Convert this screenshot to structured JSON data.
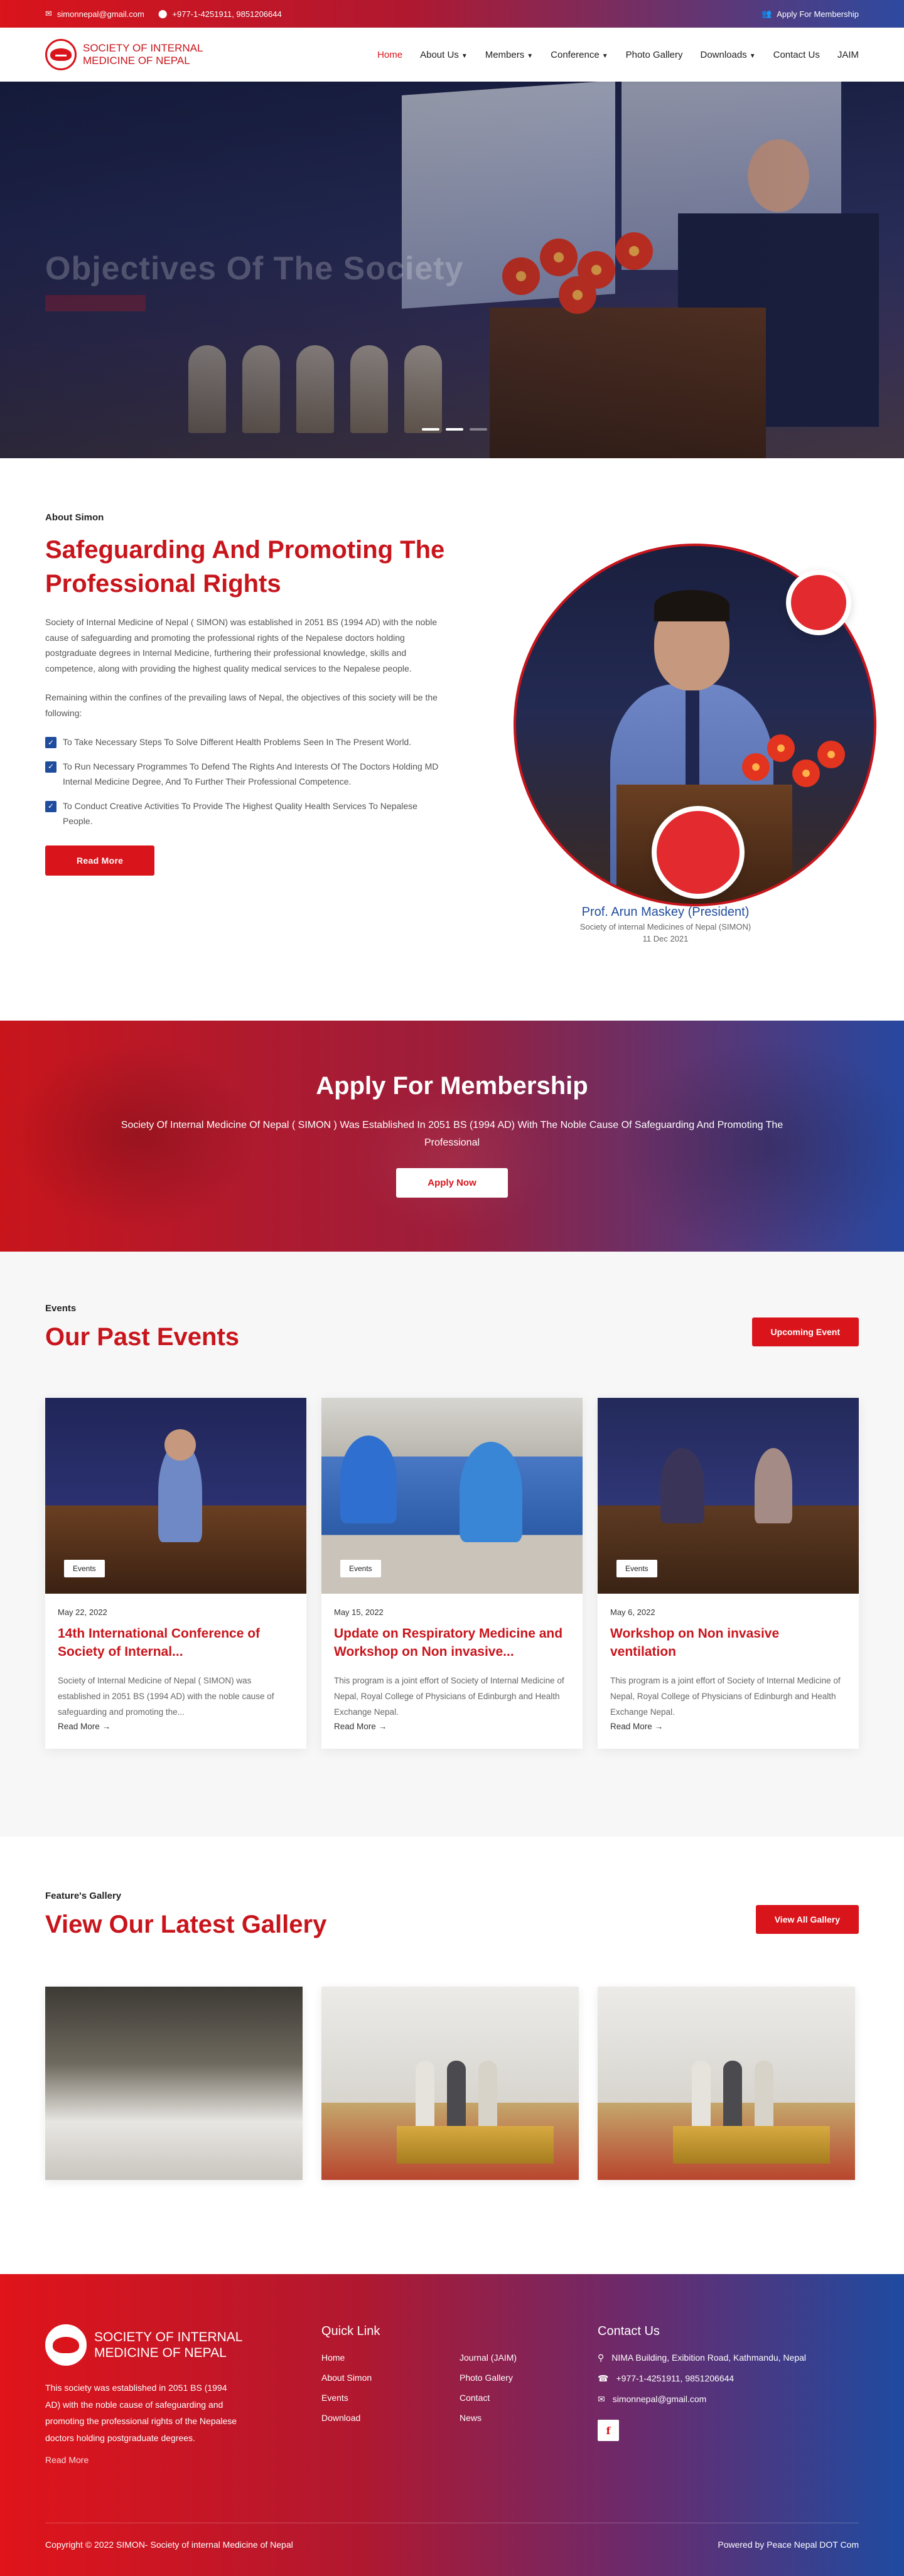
{
  "topbar": {
    "email": "simonnepal@gmail.com",
    "phone": "+977-1-4251911, 9851206644",
    "membership": "Apply For Membership"
  },
  "brand": {
    "line1": "SOCIETY OF INTERNAL",
    "line2": "MEDICINE OF NEPAL"
  },
  "nav": {
    "home": "Home",
    "about": "About Us",
    "members": "Members",
    "conference": "Conference",
    "photo_gallery": "Photo Gallery",
    "downloads": "Downloads",
    "contact": "Contact Us",
    "jaim": "JAIM"
  },
  "hero": {
    "title": "Objectives Of The Society"
  },
  "about": {
    "eyebrow": "About Simon",
    "title": "Safeguarding And Promoting The Professional Rights",
    "para1": "Society of Internal Medicine of Nepal ( SIMON) was established in 2051 BS (1994 AD) with the noble cause of safeguarding and promoting the professional rights of the Nepalese doctors holding postgraduate degrees in Internal Medicine, furthering their professional knowledge, skills and competence, along with providing the highest quality medical services to the Nepalese people.",
    "para2": "Remaining within the confines of the prevailing laws of Nepal, the objectives of this society will be the following:",
    "objectives": [
      "To Take Necessary Steps To Solve Different Health Problems Seen In The Present World.",
      "To Run Necessary Programmes To Defend The Rights And Interests Of The Doctors Holding MD Internal Medicine Degree, And To Further Their Professional Competence.",
      "To Conduct Creative Activities To Provide The Highest Quality Health Services To Nepalese People."
    ],
    "read_more": "Read More",
    "president_name": "Prof. Arun Maskey (President)",
    "president_org": "Society of internal Medicines of Nepal (SIMON)",
    "president_date": "11 Dec 2021"
  },
  "membership": {
    "title": "Apply For Membership",
    "text": "Society Of Internal Medicine Of Nepal ( SIMON ) Was Established In 2051 BS (1994 AD) With The Noble Cause Of Safeguarding And Promoting The Professional",
    "button": "Apply Now"
  },
  "events": {
    "eyebrow": "Events",
    "title": "Our Past Events",
    "button": "Upcoming Event",
    "cards": [
      {
        "tag": "Events",
        "date": "May 22, 2022",
        "title": "14th International Conference of Society of Internal...",
        "desc": "Society of Internal Medicine of Nepal ( SIMON) was established in 2051 BS (1994 AD) with the noble cause of safeguarding and promoting the...",
        "more": "Read More"
      },
      {
        "tag": "Events",
        "date": "May 15, 2022",
        "title": "Update on Respiratory Medicine and Workshop on Non invasive...",
        "desc": "This program is a joint effort of Society of Internal Medicine of Nepal, Royal College of Physicians of Edinburgh and Health Exchange Nepal.",
        "more": "Read More"
      },
      {
        "tag": "Events",
        "date": "May 6, 2022",
        "title": "Workshop on Non invasive ventilation",
        "desc": "This program is a joint effort of Society of Internal Medicine of Nepal, Royal College of Physicians of Edinburgh and Health Exchange Nepal.",
        "more": "Read More"
      }
    ]
  },
  "gallery": {
    "eyebrow": "Feature's Gallery",
    "title": "View Our Latest Gallery",
    "button": "View All Gallery"
  },
  "footer": {
    "brand_line1": "SOCIETY OF INTERNAL",
    "brand_line2": "MEDICINE OF NEPAL",
    "about": "This society was established in 2051 BS (1994 AD) with the noble cause of safeguarding and promoting the professional rights of the Nepalese doctors holding postgraduate degrees.",
    "read_more": "Read More",
    "quick_link_title": "Quick Link",
    "links": [
      "Home",
      "Journal (JAIM)",
      "About Simon",
      "Photo Gallery",
      "Events",
      "Contact",
      "Download",
      "News"
    ],
    "contact_title": "Contact Us",
    "address": "NIMA Building, Exibition Road, Kathmandu, Nepal",
    "phone": "+977-1-4251911, 9851206644",
    "email": "simonnepal@gmail.com",
    "facebook": "f",
    "copyright": "Copyright © 2022 SIMON- Society of internal Medicine of Nepal",
    "powered": "Powered by Peace Nepal DOT Com"
  }
}
